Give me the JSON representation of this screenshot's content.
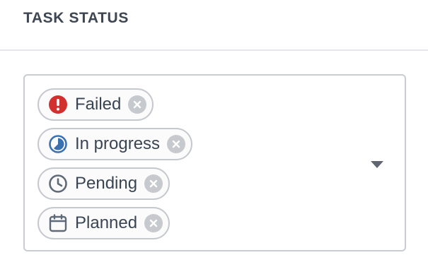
{
  "header": {
    "title": "TASK STATUS"
  },
  "select": {
    "chips": [
      {
        "label": "Failed",
        "icon": "error-icon",
        "color": "#d32f2f"
      },
      {
        "label": "In progress",
        "icon": "progress-clock-icon",
        "color": "#3a6fb0"
      },
      {
        "label": "Pending",
        "icon": "clock-icon",
        "color": "#5e6a78"
      },
      {
        "label": "Planned",
        "icon": "calendar-icon",
        "color": "#5e6a78"
      }
    ],
    "dropdown_icon": "chevron-down-icon"
  },
  "colors": {
    "text": "#3a4553",
    "chip_border": "#c5c8cd",
    "remove_button": "#c6c9cd",
    "error": "#d32f2f",
    "progress": "#3a6fb0"
  }
}
